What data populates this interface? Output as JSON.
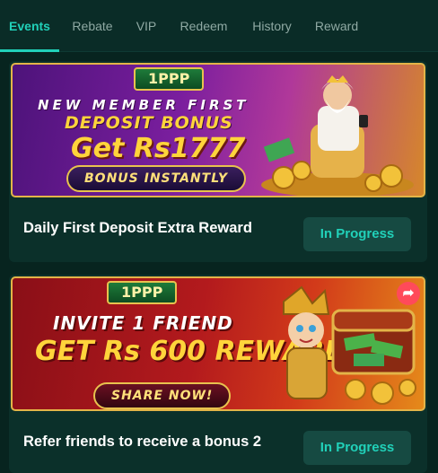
{
  "tabs": [
    {
      "label": "Events",
      "active": true
    },
    {
      "label": "Rebate",
      "active": false
    },
    {
      "label": "VIP",
      "active": false
    },
    {
      "label": "Redeem",
      "active": false
    },
    {
      "label": "History",
      "active": false
    },
    {
      "label": "Reward",
      "active": false
    }
  ],
  "colors": {
    "background": "#07241f",
    "accent": "#21d1b9",
    "card": "#0b302a",
    "status_button": "#164a42"
  },
  "events": [
    {
      "banner": {
        "logo": "1PPP",
        "line1": "NEW MEMBER FIRST",
        "line2": "DEPOSIT BONUS",
        "line3": "Get Rs1777",
        "cta": "BONUS INSTANTLY"
      },
      "title": "Daily First Deposit Extra Reward",
      "status": "In Progress"
    },
    {
      "banner": {
        "logo": "1PPP",
        "line1": "INVITE 1 FRIEND",
        "line2": "GET Rs 600 REWARD",
        "cta": "SHARE NOW!",
        "share_icon": "share-arrow-icon"
      },
      "title": "Refer friends to receive a bonus 2",
      "status": "In Progress"
    }
  ]
}
